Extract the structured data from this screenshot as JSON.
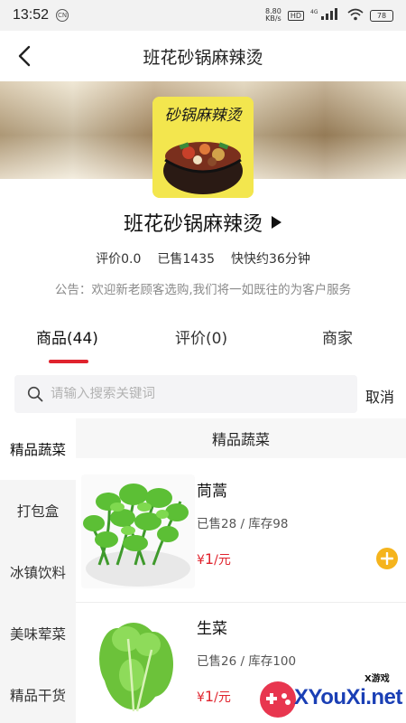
{
  "status_bar": {
    "time": "13:52",
    "left_badge": "CN",
    "speed_value": "8.80",
    "speed_unit": "KB/s",
    "hd": "HD",
    "network": "4G",
    "battery": "78"
  },
  "nav": {
    "title": "班花砂锅麻辣烫"
  },
  "shop": {
    "logo_text": "砂锅麻辣烫",
    "name": "班花砂锅麻辣烫",
    "rating": "评价0.0",
    "sold": "已售1435",
    "delivery": "快快约36分钟",
    "notice": "公告：欢迎新老顾客选购,我们将一如既往的为客户服务"
  },
  "tabs": [
    {
      "label": "商品(44)",
      "active": true
    },
    {
      "label": "评价(0)",
      "active": false
    },
    {
      "label": "商家",
      "active": false
    }
  ],
  "search": {
    "placeholder": "请输入搜索关键词",
    "cancel": "取消"
  },
  "categories": [
    {
      "label": "精品蔬菜",
      "active": true
    },
    {
      "label": "打包盒",
      "active": false
    },
    {
      "label": "冰镇饮料",
      "active": false
    },
    {
      "label": "美味荤菜",
      "active": false
    },
    {
      "label": "精品干货",
      "active": false
    }
  ],
  "section_title": "精品蔬菜",
  "products": [
    {
      "name": "茼蒿",
      "meta": "已售28 / 库存98",
      "price_symbol": "¥",
      "price_value": "1",
      "price_unit": "/元"
    },
    {
      "name": "生菜",
      "meta": "已售26 / 库存100",
      "price_symbol": "¥",
      "price_value": "1",
      "price_unit": "/元"
    }
  ],
  "watermark": {
    "small": "X游戏",
    "main": "XYouXi.net"
  },
  "colors": {
    "accent_red": "#e0232d",
    "add_button": "#f5b41d",
    "watermark_blue": "#1a3fb5"
  }
}
